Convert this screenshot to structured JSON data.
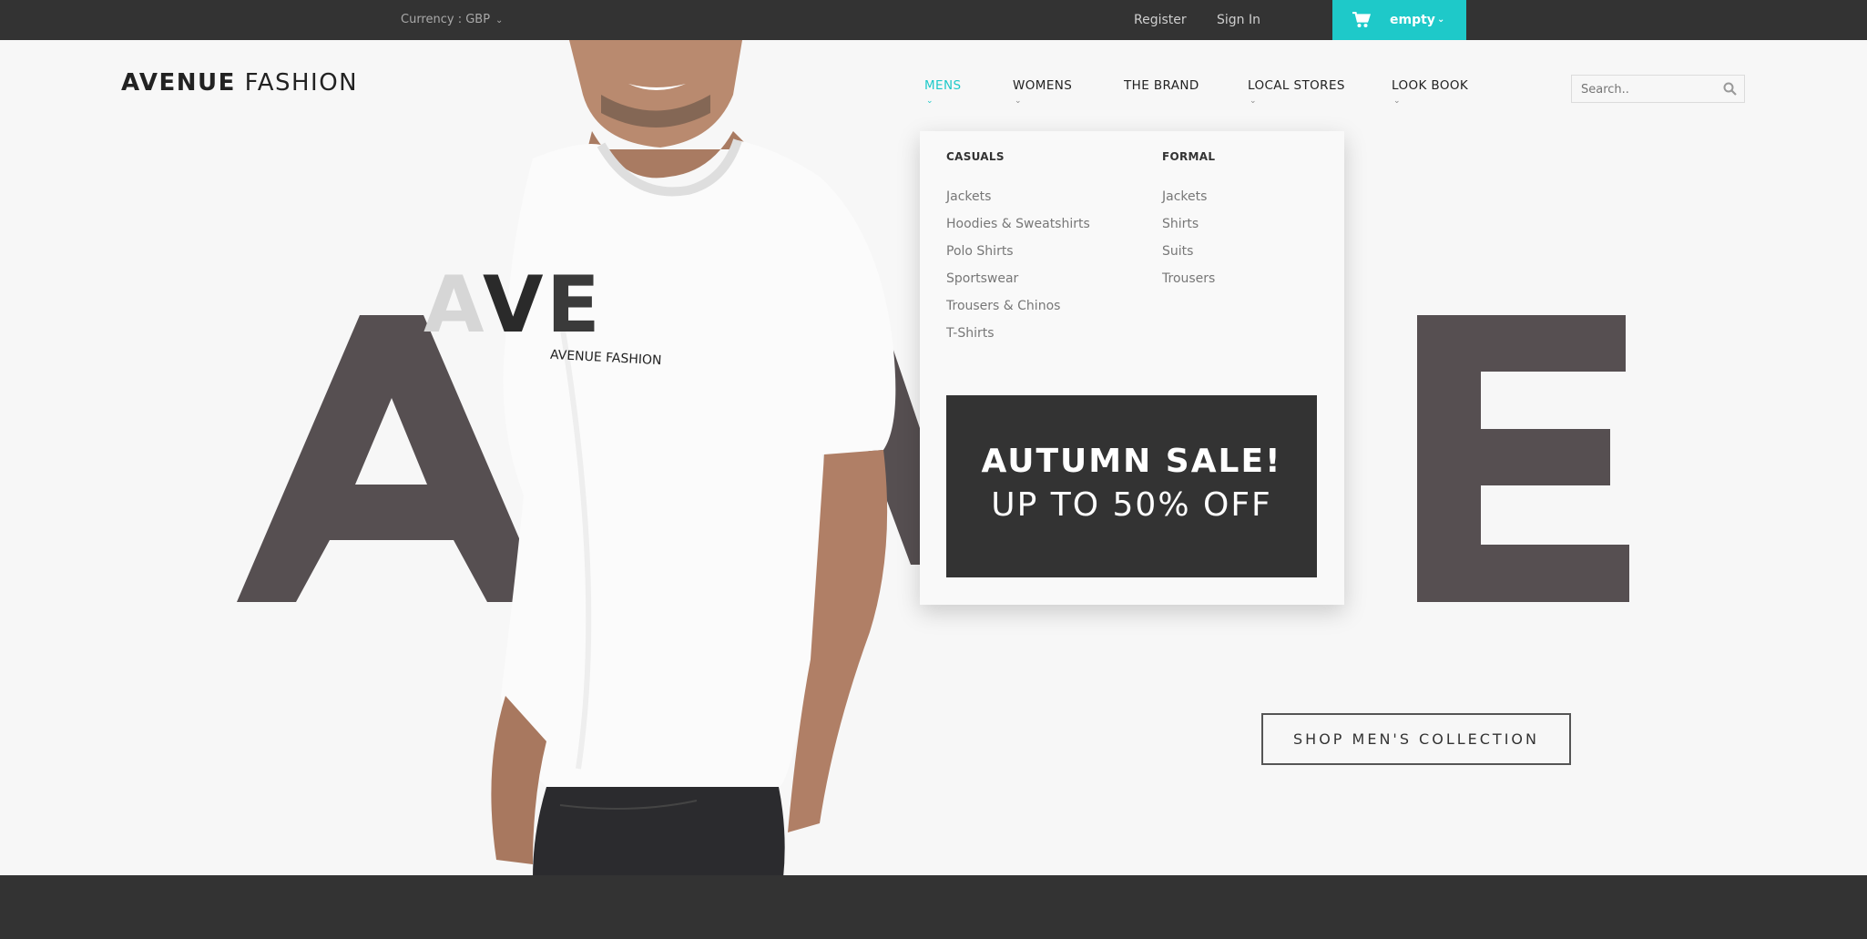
{
  "topbar": {
    "currency_label": "Currency : GBP",
    "register": "Register",
    "sign_in": "Sign In",
    "cart_label": "empty"
  },
  "logo": {
    "bold": "AVENUE",
    "light": "FASHION"
  },
  "nav": [
    {
      "label": "MENS",
      "active": true
    },
    {
      "label": "WOMENS"
    },
    {
      "label": "THE BRAND"
    },
    {
      "label": "LOCAL STORES"
    },
    {
      "label": "LOOK BOOK"
    }
  ],
  "search": {
    "placeholder": "Search.."
  },
  "mega_menu": {
    "casuals": {
      "heading": "CASUALS",
      "links": [
        "Jackets",
        "Hoodies & Sweatshirts",
        "Polo Shirts",
        "Sportswear",
        "Trousers & Chinos",
        "T-Shirts"
      ]
    },
    "formal": {
      "heading": "FORMAL",
      "links": [
        "Jackets",
        "Shirts",
        "Suits",
        "Trousers"
      ]
    },
    "promo": {
      "line1": "AUTUMN SALE!",
      "line2": "UP TO 50% OFF"
    }
  },
  "hero": {
    "big_letters": [
      "A",
      "V",
      "E"
    ],
    "tshirt_brand": "AVENUE FASHION",
    "cta": "SHOP MEN'S COLLECTION"
  },
  "colors": {
    "accent": "#1ec9c9",
    "dark": "#333333",
    "letters": "#564f51"
  },
  "icons": {
    "cart": "cart-icon",
    "search": "search-icon",
    "caret": "chevron-down-icon"
  }
}
